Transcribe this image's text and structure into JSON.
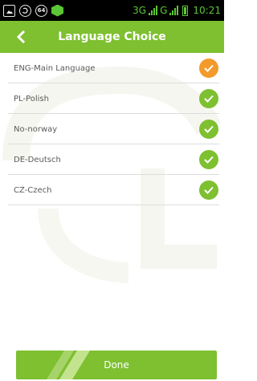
{
  "status_bar": {
    "left_icons": [
      "image-icon",
      "sync-icon",
      "badge-64-icon",
      "green-app-icon"
    ],
    "badge_text": "64",
    "network_text": "3G",
    "network_text_2": "G",
    "time": "10:21",
    "accent_color": "#5cc636"
  },
  "header": {
    "title": "Language Choice",
    "back_icon": "chevron-left-icon",
    "background": "#7ec030"
  },
  "languages": [
    {
      "label": "ENG-Main Language",
      "checked": true,
      "check_color": "#f39a2b"
    },
    {
      "label": "PL-Polish",
      "checked": true,
      "check_color": "#7ec030"
    },
    {
      "label": "No-norway",
      "checked": true,
      "check_color": "#7ec030"
    },
    {
      "label": "DE-Deutsch",
      "checked": true,
      "check_color": "#7ec030"
    },
    {
      "label": "CZ-Czech",
      "checked": true,
      "check_color": "#7ec030"
    }
  ],
  "footer": {
    "done_label": "Done"
  }
}
